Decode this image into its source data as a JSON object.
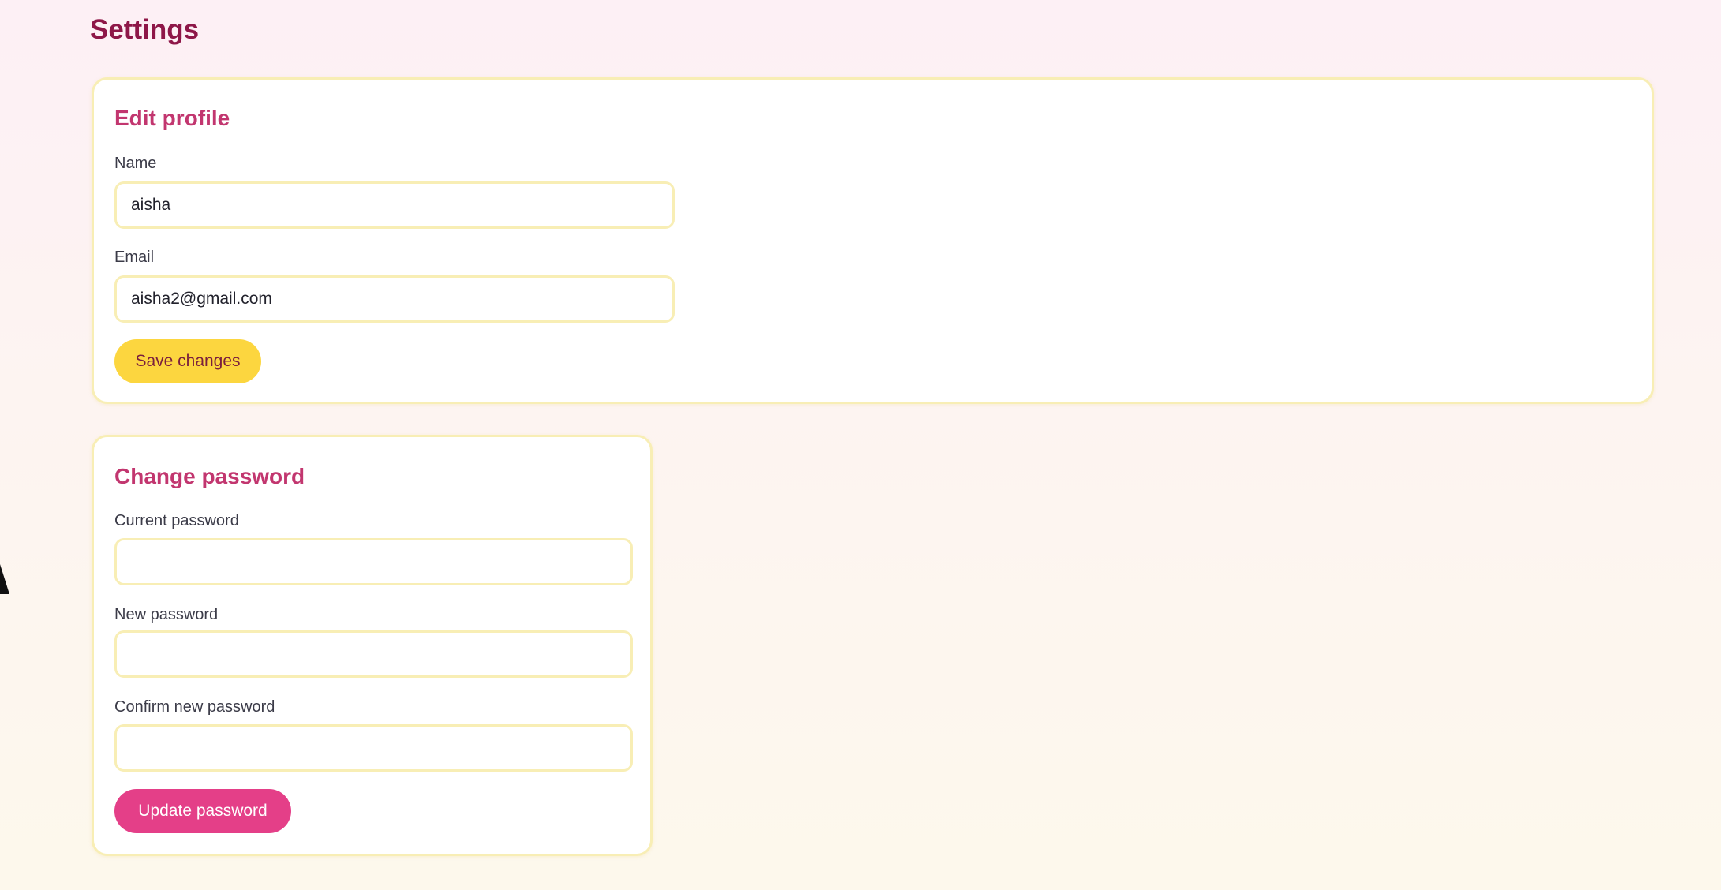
{
  "page": {
    "title": "Settings"
  },
  "profile": {
    "heading": "Edit profile",
    "name_label": "Name",
    "name_value": "aisha",
    "email_label": "Email",
    "email_value": "aisha2@gmail.com",
    "save_label": "Save changes"
  },
  "password": {
    "heading": "Change password",
    "current_label": "Current password",
    "current_value": "",
    "new_label": "New password",
    "new_value": "",
    "confirm_label": "Confirm new password",
    "confirm_value": "",
    "update_label": "Update password"
  },
  "colors": {
    "title": "#8e1748",
    "card_heading": "#c2366f",
    "card_border": "#f8eeb5",
    "save_button": "#fcd63f",
    "update_button": "#e43f88"
  },
  "icons": {
    "cursor": "mouse-cursor-icon"
  }
}
